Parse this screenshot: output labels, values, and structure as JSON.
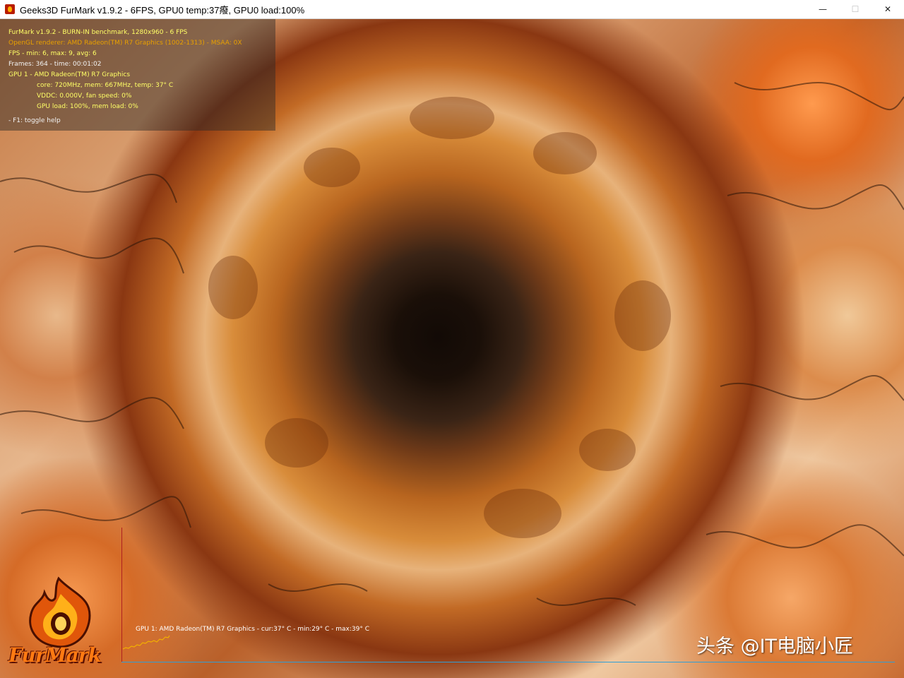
{
  "window": {
    "title": "Geeks3D FurMark v1.9.2 - 6FPS, GPU0 temp:37癈, GPU0 load:100%",
    "controls": {
      "minimize": "—",
      "maximize": "☐",
      "close": "✕"
    }
  },
  "hud": {
    "line1": "FurMark v1.9.2 - BURN-IN benchmark, 1280x960 - 6 FPS",
    "line2": "OpenGL renderer: AMD Radeon(TM) R7 Graphics (1002-1313) - MSAA: 0X",
    "line3": "FPS - min: 6, max: 9, avg: 6",
    "line4": "Frames: 364 - time: 00:01:02",
    "line5": "GPU 1 - AMD Radeon(TM) R7 Graphics",
    "line6": "core: 720MHz, mem: 667MHz, temp: 37° C",
    "line7": "VDDC: 0.000V, fan speed: 0%",
    "line8": "GPU load: 100%, mem load: 0%",
    "line9": "- F1: toggle help"
  },
  "graph": {
    "label": "GPU 1: AMD Radeon(TM) R7 Graphics - cur:37° C - min:29° C - max:39° C"
  },
  "logo": {
    "text": "FurMark"
  },
  "watermark": "头条 @IT电脑小匠",
  "colors": {
    "hud_yellow": "#ffff66",
    "hud_orange": "#e8a000",
    "graph_axis_x": "#2f9fd6",
    "graph_axis_y": "#b02020"
  }
}
